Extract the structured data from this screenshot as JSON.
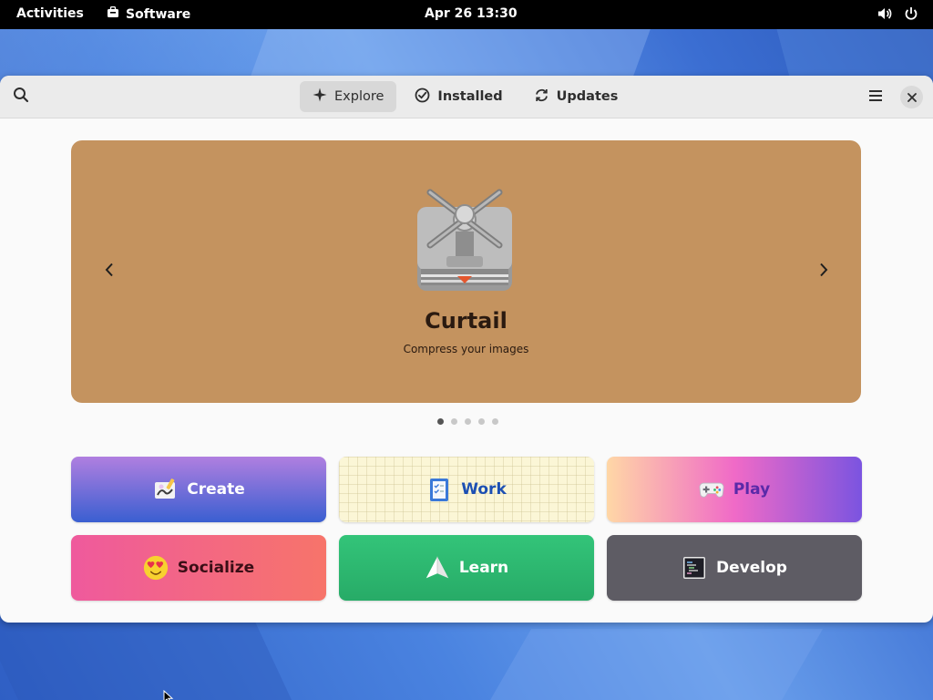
{
  "topbar": {
    "activities": "Activities",
    "app_name": "Software",
    "clock": "Apr 26  13:30"
  },
  "header": {
    "tabs": [
      {
        "label": "Explore",
        "icon": "sparkle-icon",
        "active": true
      },
      {
        "label": "Installed",
        "icon": "check-circle-icon",
        "active": false
      },
      {
        "label": "Updates",
        "icon": "refresh-icon",
        "active": false
      }
    ]
  },
  "banner": {
    "app_name": "Curtail",
    "description": "Compress your images",
    "background": "#c4935f",
    "slide_count": 5,
    "active_slide": 1
  },
  "categories": [
    {
      "label": "Create",
      "icon": "create-icon"
    },
    {
      "label": "Work",
      "icon": "work-icon"
    },
    {
      "label": "Play",
      "icon": "gamepad-icon"
    },
    {
      "label": "Socialize",
      "icon": "emoji-icon"
    },
    {
      "label": "Learn",
      "icon": "paper-plane-icon"
    },
    {
      "label": "Develop",
      "icon": "terminal-icon"
    }
  ]
}
